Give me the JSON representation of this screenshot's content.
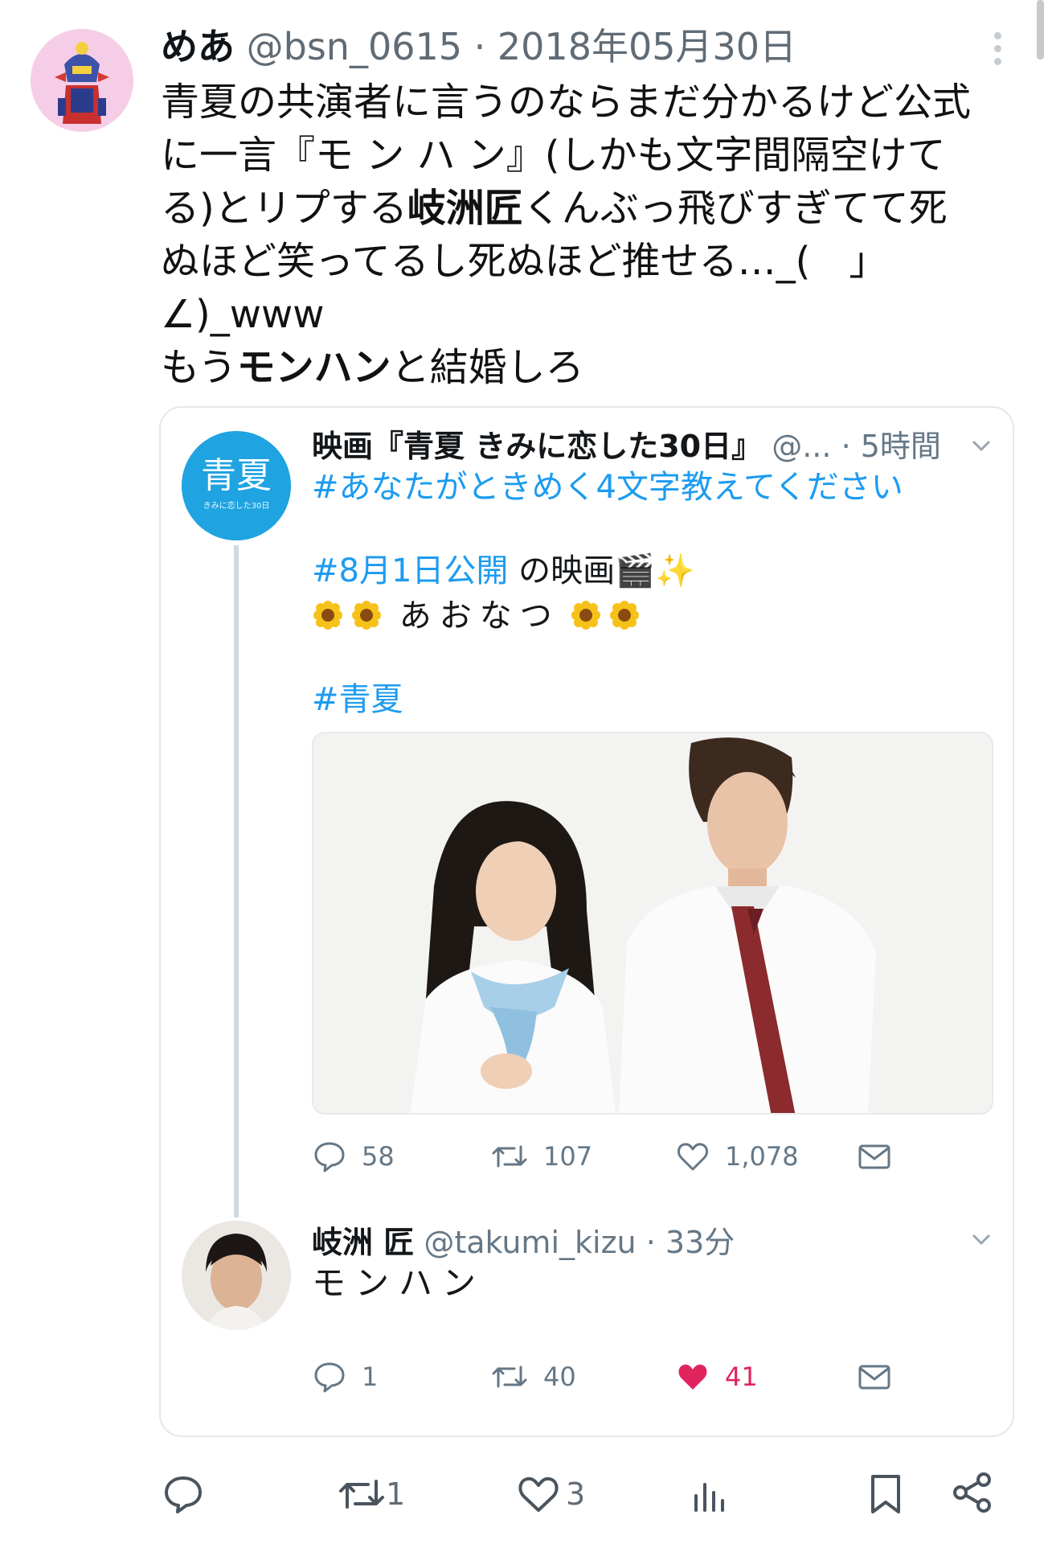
{
  "main_tweet": {
    "display_name": "めあ",
    "handle": "@bsn_0615",
    "separator": "·",
    "date": "2018年05月30日",
    "text_lines": [
      [
        "青夏の共演者に言うのならまだ分かるけど公式"
      ],
      [
        "に一言『モ ン ハ ン』(しかも文字間隔空けて"
      ],
      [
        "る)とリプする",
        "岐洲匠",
        "くんぶっ飛びすぎてて死"
      ],
      [
        "ぬほど笑ってるし死ぬほど推せる…_(　」"
      ],
      [
        "∠)_www"
      ],
      [
        "もう",
        "モンハン",
        "と結婚しろ"
      ]
    ]
  },
  "quoted_tweet": {
    "display_name": "映画『青夏 きみに恋した30日』",
    "handle": "@...",
    "separator": "·",
    "time": "5時間",
    "avatar_text": "青夏",
    "avatar_subtext": "きみに恋した30日",
    "hashtag_question": "#あなたがときめく4文字教えてください",
    "hashtag_release": "#8月1日公開",
    "release_suffix": " の映画",
    "clapper_emoji": "🎬",
    "sparkle_emoji": "✨",
    "aonatsu": "あおなつ",
    "hashtag_title": "#青夏",
    "actions": {
      "replies": "58",
      "retweets": "107",
      "likes": "1,078"
    }
  },
  "reply_tweet": {
    "display_name": "岐洲 匠",
    "handle": "@takumi_kizu",
    "separator": "·",
    "time": "33分",
    "text": "モンハン",
    "actions": {
      "replies": "1",
      "retweets": "40",
      "likes": "41"
    }
  },
  "bottom_actions": {
    "retweets": "1",
    "likes": "3"
  },
  "colors": {
    "link_blue": "#1d9bf0",
    "liked_red": "#e0245e",
    "muted": "#657786"
  }
}
